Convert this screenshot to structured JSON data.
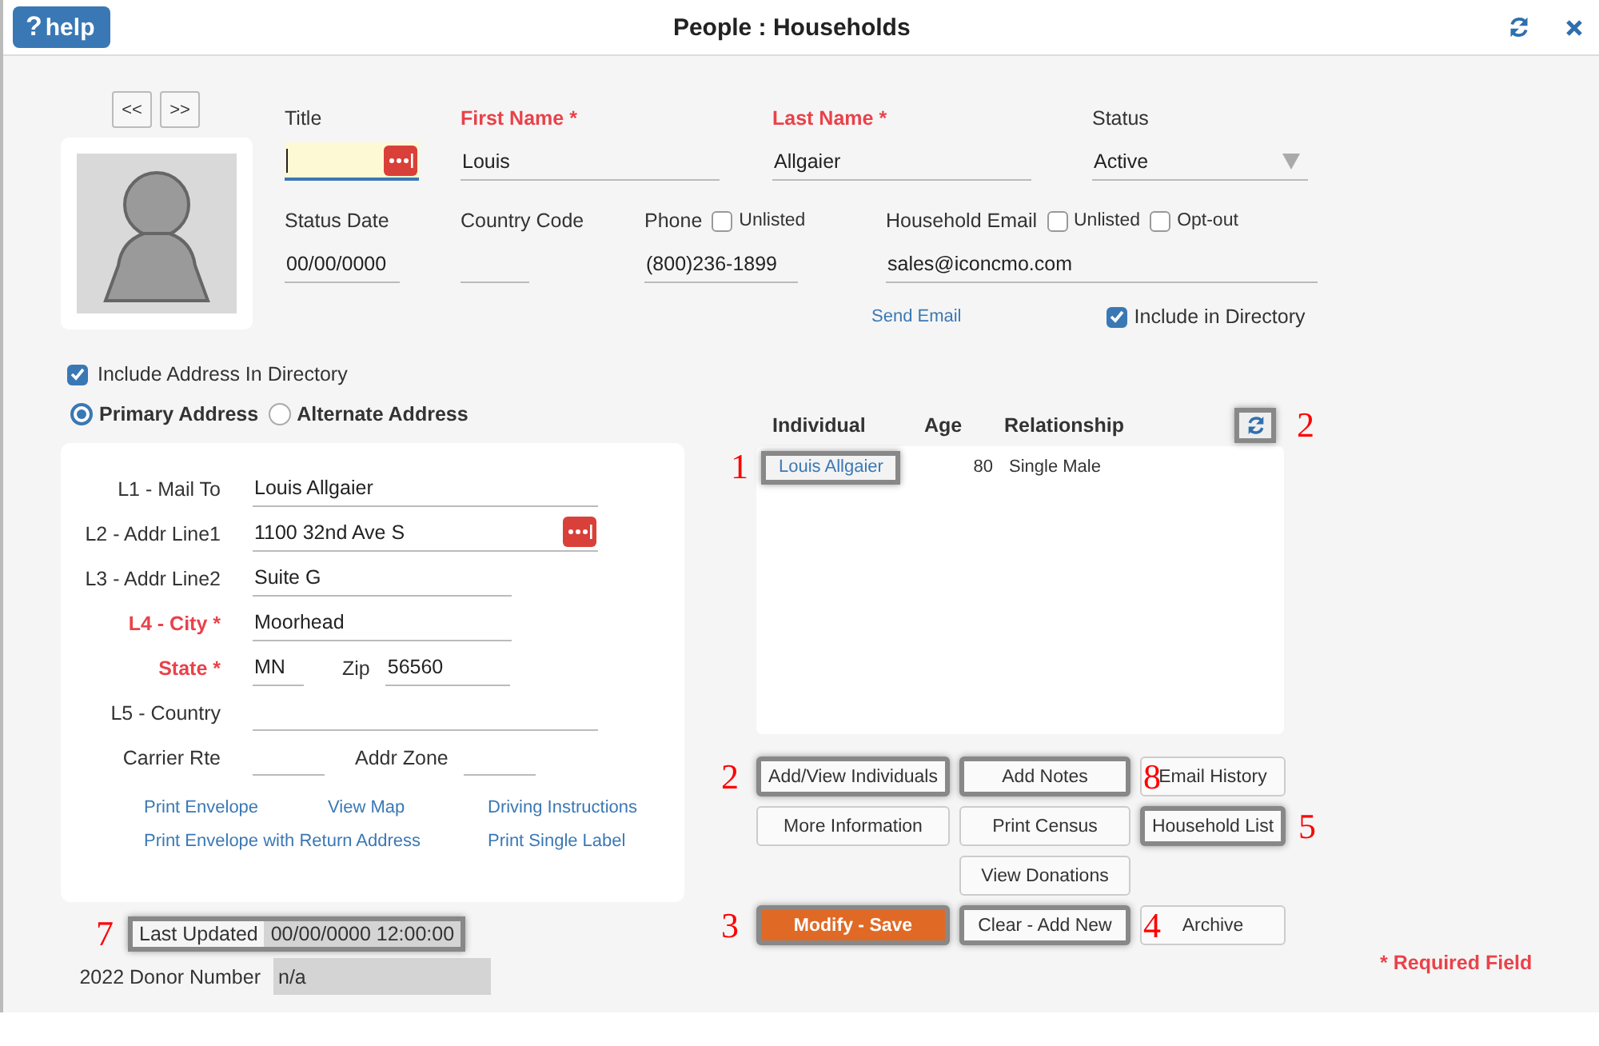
{
  "header": {
    "help_icon": "?",
    "help": "help",
    "title": "People : Households"
  },
  "pager": [
    "<<",
    ">>"
  ],
  "row1": [
    {
      "label": "Title",
      "required": false,
      "focused": true,
      "picker": true
    },
    {
      "label": "First Name *",
      "value": "Louis",
      "required": true
    },
    {
      "label": "Last Name *",
      "value": "Allgaier",
      "required": true
    },
    {
      "label": "Status",
      "value": "Active",
      "required": false,
      "kind": "dropdown"
    }
  ],
  "row2": [
    {
      "label": "Status Date",
      "value": "00/00/0000"
    },
    {
      "label": "Country Code"
    },
    {
      "label": "Phone",
      "value": "(800)236-1899",
      "checkboxes": [
        {
          "label": "Unlisted",
          "checked": false
        }
      ]
    },
    {
      "label": "Household Email",
      "value": "sales@iconcmo.com",
      "checkboxes": [
        {
          "label": "Unlisted",
          "checked": false
        },
        {
          "label": "Opt-out",
          "checked": false
        }
      ]
    }
  ],
  "send_email": "Send Email",
  "include_in_directory": {
    "label": "Include in Directory",
    "checked": true
  },
  "include_address": {
    "label": "Include Address In Directory",
    "checked": true
  },
  "address_types": [
    {
      "label": "Primary Address",
      "selected": true
    },
    {
      "label": "Alternate Address",
      "selected": false
    }
  ],
  "address": [
    {
      "label": "L1 - Mail To",
      "value": "Louis Allgaier",
      "required": false,
      "kind": "full"
    },
    {
      "label": "L2 - Addr Line1",
      "value": "1100 32nd Ave S",
      "required": false,
      "kind": "full",
      "picker": true
    },
    {
      "label": "L3 - Addr Line2",
      "value": "Suite G",
      "required": false,
      "kind": "medium"
    },
    {
      "label": "L4 - City *",
      "value": "Moorhead",
      "required": true,
      "kind": "medium"
    },
    {
      "label": "State *",
      "value": "MN",
      "required": true,
      "kind": "pair",
      "label2": "Zip",
      "value2": "56560"
    },
    {
      "label": "L5 - Country",
      "required": false,
      "kind": "full"
    },
    {
      "label": "Carrier Rte",
      "required": false,
      "kind": "pair",
      "label2": "Addr Zone"
    }
  ],
  "address_links": [
    [
      "Print Envelope",
      "View Map",
      "Driving Instructions"
    ],
    [
      "Print Envelope with Return Address",
      "Print Single Label"
    ]
  ],
  "individuals": {
    "columns": [
      "Individual",
      "Age",
      "Relationship"
    ],
    "refresh": {
      "highlighted": true,
      "callout": "2"
    },
    "rows": [
      {
        "individual": "Louis Allgaier",
        "age": "80",
        "relationship": "Single Male",
        "highlighted": true,
        "callout": "1"
      }
    ]
  },
  "button_rows": [
    [
      {
        "label": "Add/View Individuals",
        "kind": "default",
        "highlighted": true,
        "callout": "2",
        "callout_left": true
      },
      {
        "label": "Add Notes",
        "kind": "default",
        "highlighted": true,
        "callout": "8",
        "callout_left": false
      },
      {
        "label": "Email History",
        "kind": "default",
        "highlighted": false
      }
    ],
    [
      {
        "label": "More Information",
        "kind": "default",
        "highlighted": false
      },
      {
        "label": "Print Census",
        "kind": "default",
        "highlighted": false
      },
      {
        "label": "Household List",
        "kind": "default",
        "highlighted": true,
        "callout": "5",
        "callout_left": false
      }
    ],
    [
      {
        "label": "View Donations",
        "kind": "default",
        "highlighted": false
      }
    ],
    [
      {
        "label": "Modify - Save",
        "kind": "primary",
        "highlighted": true,
        "callout": "3",
        "callout_left": true
      },
      {
        "label": "Clear - Add New",
        "kind": "default",
        "highlighted": true,
        "callout": "4",
        "callout_left": false
      },
      {
        "label": "Archive",
        "kind": "default",
        "highlighted": false
      }
    ]
  ],
  "last_updated": {
    "label": "Last Updated",
    "value": "00/00/0000 12:00:00",
    "highlighted": true,
    "callout": "7"
  },
  "donor": {
    "label": "2022 Donor Number",
    "value": "n/a"
  },
  "required_note": "* Required Field"
}
